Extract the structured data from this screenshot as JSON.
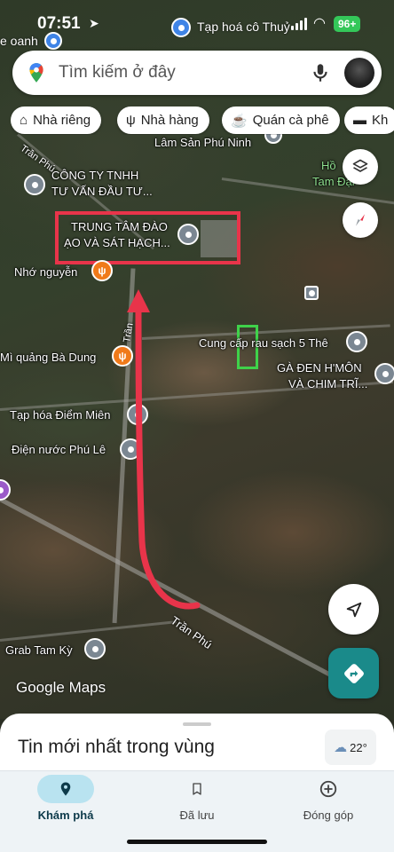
{
  "status_bar": {
    "time": "07:51",
    "nearby_store": "Tạp hoá cô Thuỷ",
    "edge_label": "e oanh",
    "battery": "96+"
  },
  "search": {
    "placeholder": "Tìm kiếm ở đây"
  },
  "chips": [
    {
      "label": "Nhà riêng",
      "icon": "home-icon"
    },
    {
      "label": "Nhà hàng",
      "icon": "restaurant-icon"
    },
    {
      "label": "Quán cà phê",
      "icon": "coffee-icon"
    },
    {
      "label": "Kh",
      "icon": "hotel-icon"
    }
  ],
  "map": {
    "places": {
      "lam_san": "Lâm Sản Phú Ninh",
      "ho": "Hồ",
      "tam_dai": "Tam Đại",
      "cong_ty_1": "CÔNG TY TNHH",
      "cong_ty_2": "TƯ VẤN ĐẦU TƯ...",
      "trung_tam_1": "TRUNG TÂM ĐÀO",
      "trung_tam_2": "ẠO VÀ SÁT HẠCH...",
      "nho_nguyen": "Nhớ nguyễn",
      "cung_cap": "Cung cấp rau sạch 5 Thê",
      "ga_den_1": "GÀ ĐEN H'MÔN",
      "ga_den_2": "VÀ CHIM TRĨ...",
      "mi_quang": "Mì quảng Bà Dung",
      "tap_hoa": "Tạp hóa Điểm Miên",
      "dien_nuoc": "Điện nước Phú Lê",
      "grab": "Grab Tam Kỳ"
    },
    "streets": {
      "tran_phu_top": "Trần Phú",
      "tran_phu_mid": "Trần",
      "tran_phu_bottom": "Trần Phú"
    },
    "attribution_google": "Google",
    "attribution_maps": "Maps",
    "annotation_colors": {
      "arrow": "#e8344a",
      "box_red": "#e8344a",
      "box_green": "#3fd24a"
    }
  },
  "sheet": {
    "title": "Tin mới nhất trong vùng",
    "temperature": "22°"
  },
  "nav": [
    {
      "label": "Khám phá",
      "icon": "explore-pin-icon",
      "active": true
    },
    {
      "label": "Đã lưu",
      "icon": "bookmark-icon",
      "active": false
    },
    {
      "label": "Đóng góp",
      "icon": "add-circle-icon",
      "active": false
    }
  ],
  "colors": {
    "accent": "#1a8a8a",
    "active_nav": "#b9e3f0"
  }
}
